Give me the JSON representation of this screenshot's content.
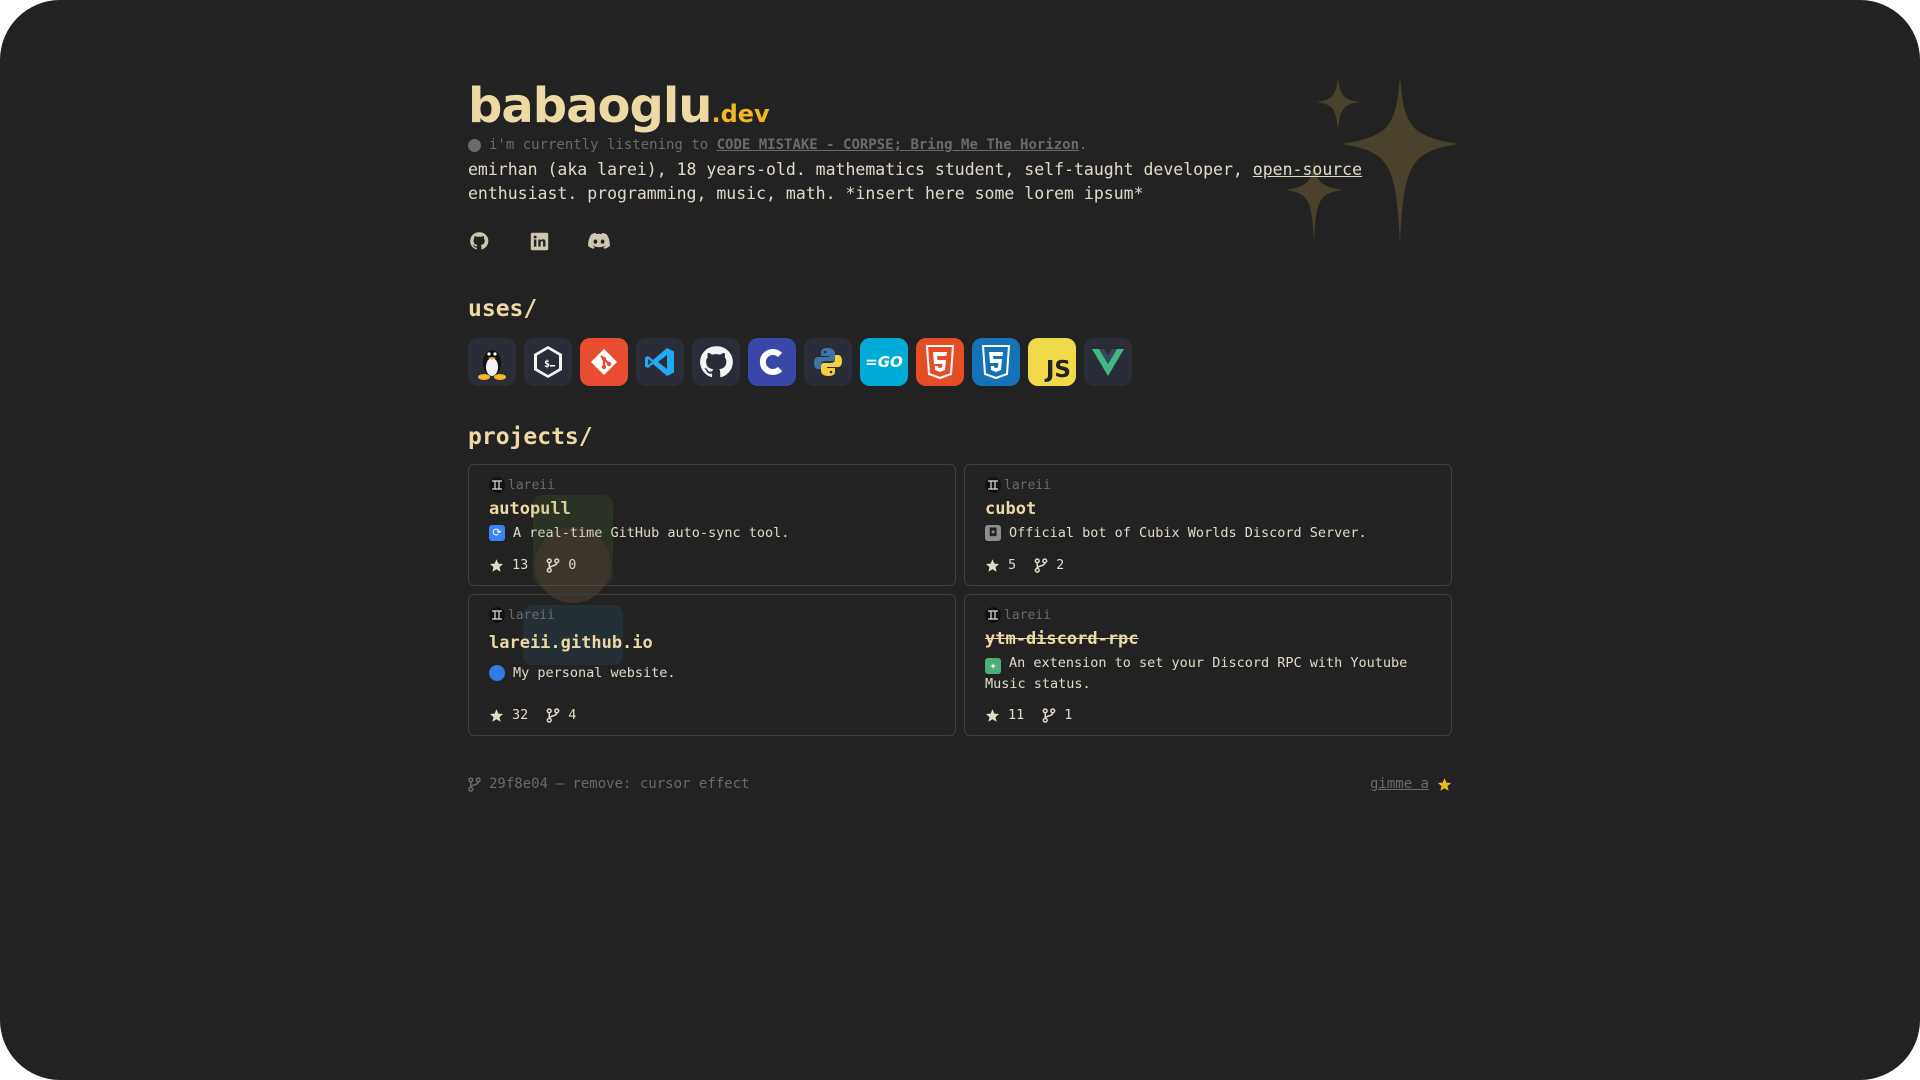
{
  "header": {
    "brand_main": "babaoglu",
    "brand_tld": ".dev",
    "listening_prefix": "i'm currently listening to",
    "listening_track": "CODE MISTAKE - CORPSE; Bring Me The Horizon",
    "listening_suffix": ".",
    "bio_text": "emirhan (aka larei), 18 years-old. mathematics student, self-taught developer, ",
    "bio_link": "open-source",
    "bio_text2": " enthusiast. programming, music, math. *insert here some lorem ipsum*"
  },
  "socials": [
    {
      "name": "github-icon"
    },
    {
      "name": "linkedin-icon"
    },
    {
      "name": "discord-icon"
    }
  ],
  "uses": {
    "heading": "uses/",
    "tools": [
      {
        "name": "linux-icon",
        "bg": "#2a2d38"
      },
      {
        "name": "bash-icon",
        "bg": "#2a2d38"
      },
      {
        "name": "git-icon",
        "bg": "#e84d31"
      },
      {
        "name": "vscode-icon",
        "bg": "#2a2d38"
      },
      {
        "name": "github-icon",
        "bg": "#2a2d38"
      },
      {
        "name": "c-icon",
        "bg": "#3947a9",
        "glyph": "C"
      },
      {
        "name": "python-icon",
        "bg": "#2a2d38"
      },
      {
        "name": "go-icon",
        "bg": "#00acd7",
        "glyph": "=GO"
      },
      {
        "name": "html5-icon",
        "bg": "#e44d26",
        "glyph": "5"
      },
      {
        "name": "css3-icon",
        "bg": "#1572b6",
        "glyph": "3"
      },
      {
        "name": "javascript-icon",
        "bg": "#f0d94a",
        "glyph": "JS"
      },
      {
        "name": "vue-icon",
        "bg": "#2a2d38"
      }
    ]
  },
  "projects": {
    "heading": "projects/",
    "repos": [
      {
        "owner": "lareii",
        "name": "autopull",
        "emoji_bg": "#3b82f6",
        "emoji": "⟳",
        "description": "A real-time GitHub auto-sync tool.",
        "stars": "13",
        "forks": "0",
        "strike": false,
        "size": "short"
      },
      {
        "owner": "lareii",
        "name": "cubot",
        "emoji_bg": "#8d8d8d",
        "emoji": "◘",
        "description": "Official bot of Cubix Worlds Discord Server.",
        "stars": "5",
        "forks": "2",
        "strike": false,
        "size": "short"
      },
      {
        "owner": "lareii",
        "name": "lareii.github.io",
        "emoji_bg": "#2f7de1",
        "emoji": "●",
        "description": "My personal website.",
        "stars": "32",
        "forks": "4",
        "strike": false,
        "size": "tall"
      },
      {
        "owner": "lareii",
        "name": "ytm-discord-rpc",
        "emoji_bg": "#4bb07a",
        "emoji": "✦",
        "description": "An extension to set your Discord RPC with Youtube Music status.",
        "stars": "11",
        "forks": "1",
        "strike": true,
        "size": "tall"
      }
    ]
  },
  "footer": {
    "commit_hash": "29f8e04",
    "commit_sep": "—",
    "commit_message": "remove: cursor effect",
    "star_link": "gimme a"
  },
  "colors": {
    "background": "#222222",
    "accent": "#f2b824",
    "text": "#e2dac7",
    "heading": "#ecd9a4"
  }
}
